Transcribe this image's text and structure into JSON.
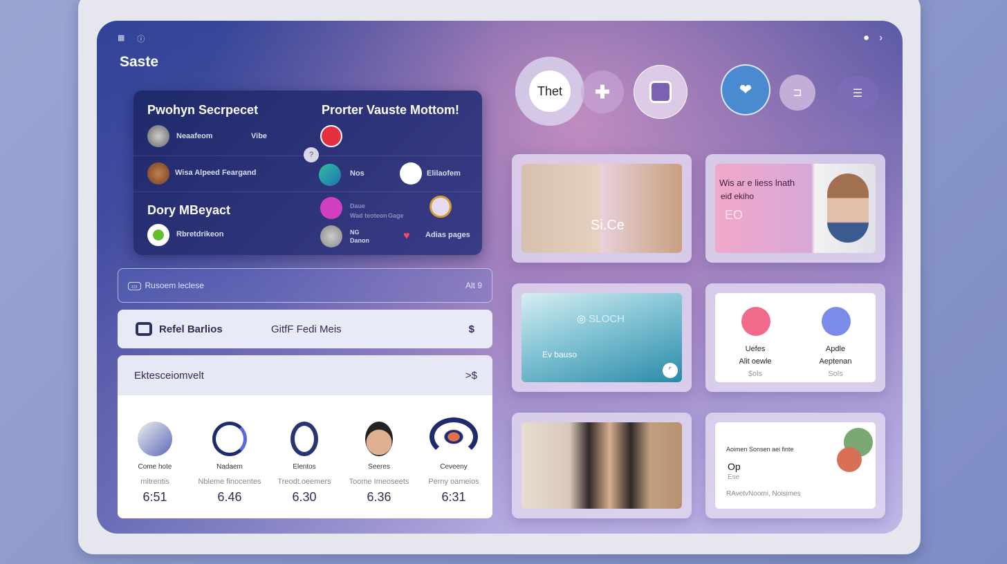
{
  "header": {
    "title": "Saste",
    "top_icons": [
      "grid-icon",
      "info-icon"
    ],
    "right_icons": [
      "refresh-icon",
      "chevron-right-icon"
    ]
  },
  "dark_card": {
    "left_title": "Pwohyn Secrpecet",
    "right_title": "Prorter Vauste Mottom!",
    "left_rows": [
      {
        "label": "Neaafeom",
        "meta": "Vibe"
      },
      {
        "label": "Wisa Alpeed Feargand"
      }
    ],
    "section2_title": "Dory MBeyact",
    "section2_row": {
      "label": "Rbretdrikeon"
    },
    "right_rows": [
      {
        "label": "Nos"
      },
      {
        "label": "Elilaofem"
      },
      {
        "label": "Daue",
        "sub": "Wad teoteon",
        "meta": "Gage"
      },
      {
        "label": "NG",
        "sub": "Danon"
      },
      {
        "label": "Adias pages"
      }
    ]
  },
  "search": {
    "placeholder": "Rusoem leclese",
    "shortcut": "Alt 9"
  },
  "section_bar": {
    "left": "Refel Barlios",
    "center": "GitfF Fedi Meis",
    "icon": "dollar-icon"
  },
  "stats": {
    "title": "Ektesceiomvelt",
    "action": ">$",
    "items": [
      {
        "name": "Come hote",
        "sub": "mitrentis",
        "value": "6:51"
      },
      {
        "name": "Nadaem",
        "sub": "Nbleme finocentes",
        "value": "6.46"
      },
      {
        "name": "Elentos",
        "sub": "Treodt.oeemers",
        "value": "6.30"
      },
      {
        "name": "Seeres",
        "sub": "Toome Imeoseets",
        "value": "6.36"
      },
      {
        "name": "Ceveeny",
        "sub": "Perny oameios",
        "value": "6:31"
      }
    ]
  },
  "action_buttons": [
    {
      "label": "Thet"
    },
    {
      "icon": "plus-icon"
    },
    {
      "icon": "layout-icon"
    },
    {
      "icon": "user-heart-icon"
    },
    {
      "icon": "link-icon"
    },
    {
      "icon": "menu-icon"
    }
  ],
  "cards": [
    {
      "type": "photo",
      "overlay": "Si.Ce"
    },
    {
      "type": "promo",
      "title": "Wis ar e liess lnath",
      "sub": "eiđ ekiho",
      "tag": "EO"
    },
    {
      "type": "photo",
      "brand": "SLOCH",
      "caption": "Ev bauso"
    },
    {
      "type": "apps",
      "items": [
        {
          "name": "Uefes",
          "sub": "Alit oewle",
          "price": "$ols"
        },
        {
          "name": "Apdle",
          "sub": "Aeptenan",
          "price": "Sols"
        }
      ]
    },
    {
      "type": "photo"
    },
    {
      "type": "info",
      "title": "Aoimen Sonsen aei finte",
      "big": "Op",
      "small": "Ese",
      "footer": "RAvetvNoomi, Noisimes"
    }
  ],
  "colors": {
    "accent": "#3b4a98",
    "dark_card": "#1f2a6a",
    "pink": "#f06a8a",
    "blue": "#7a8ce8"
  }
}
